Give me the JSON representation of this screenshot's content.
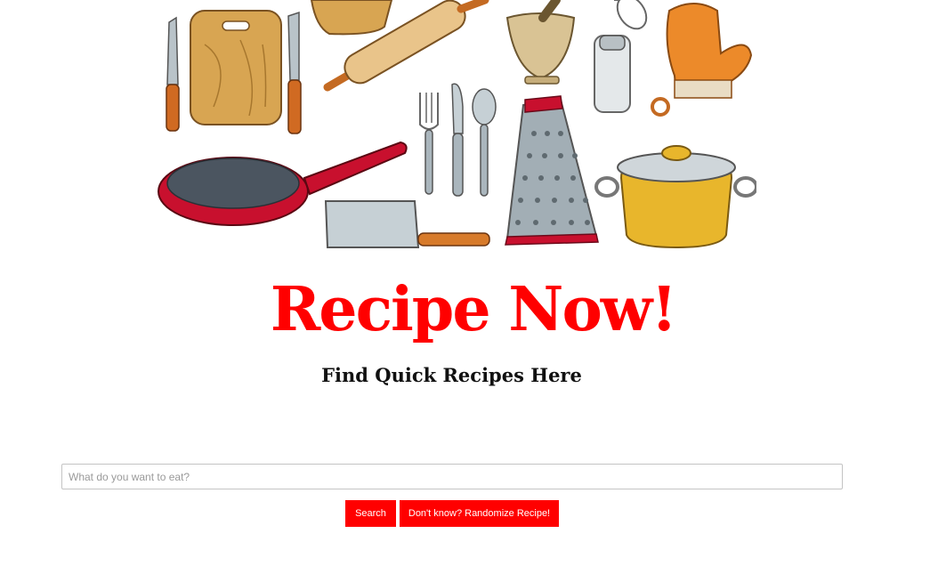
{
  "app": {
    "title": "Recipe Now!",
    "subtitle": "Find Quick Recipes Here"
  },
  "hero_image": {
    "description": "kitchen-utensils-illustration",
    "accent_colors": [
      "#c8102e",
      "#e07b24",
      "#d4a73a",
      "#8a9aa6"
    ]
  },
  "search": {
    "placeholder": "What do you want to eat?",
    "value": ""
  },
  "buttons": {
    "search_label": "Search",
    "random_label": "Don't know? Randomize Recipe!"
  },
  "colors": {
    "brand": "#ff0000",
    "subtitle": "#111111",
    "input_border": "#c4c4c4"
  }
}
